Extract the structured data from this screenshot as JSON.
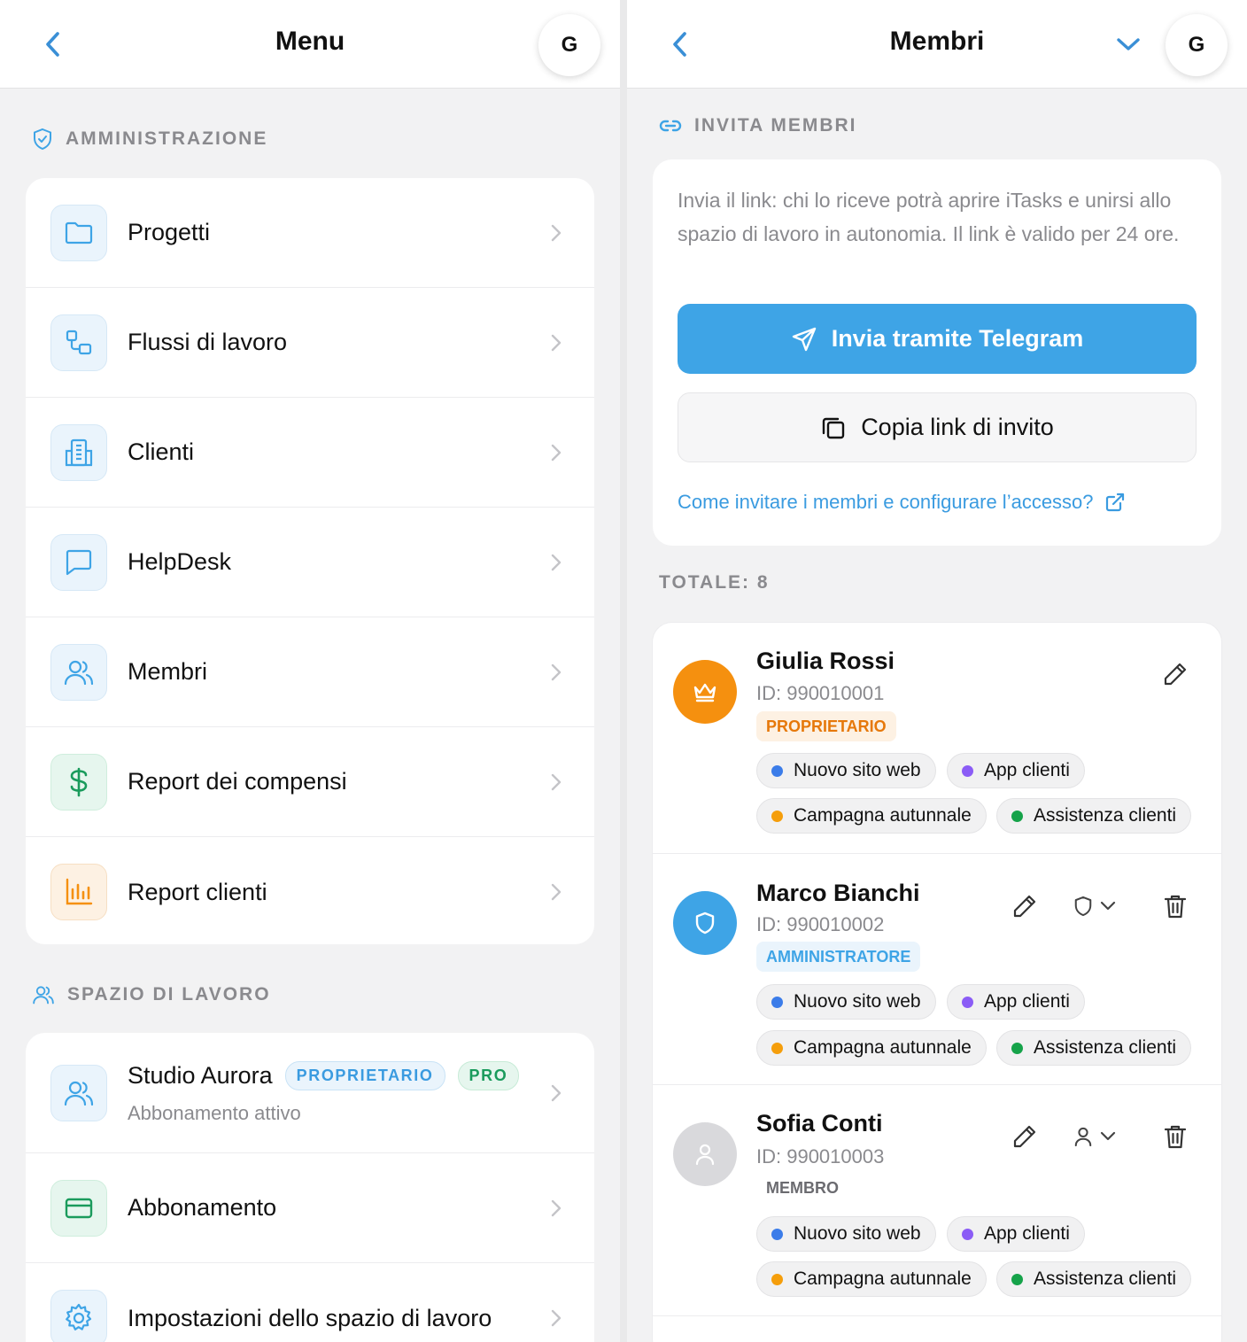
{
  "colors": {
    "accent": "#3ea4e6",
    "link": "#3a9be0",
    "owner_orange": "#f5900f",
    "admin_blue": "#3ea4e6",
    "member_gray": "#d9d9dc",
    "dot_blue": "#3b7ce9",
    "dot_purple": "#8b5cf6",
    "dot_orange": "#f59e0b",
    "dot_green": "#16a34a"
  },
  "left": {
    "header": {
      "title": "Menu",
      "avatar_initial": "G"
    },
    "admin_section": {
      "title": "AMMINISTRAZIONE",
      "icon": "shield-check-icon",
      "items": [
        {
          "label": "Progetti",
          "icon": "folder-icon"
        },
        {
          "label": "Flussi di lavoro",
          "icon": "workflow-icon"
        },
        {
          "label": "Clienti",
          "icon": "building-icon"
        },
        {
          "label": "HelpDesk",
          "icon": "chat-bubble-icon"
        },
        {
          "label": "Membri",
          "icon": "users-icon"
        },
        {
          "label": "Report dei compensi",
          "icon": "dollar-icon"
        },
        {
          "label": "Report clienti",
          "icon": "bar-chart-icon"
        }
      ]
    },
    "workspace_section": {
      "title": "SPAZIO DI LAVORO",
      "icon": "users-icon",
      "workspace": {
        "name": "Studio Aurora",
        "role_badge": "PROPRIETARIO",
        "plan_badge": "PRO",
        "subtitle": "Abbonamento attivo"
      },
      "items": [
        {
          "label": "Abbonamento",
          "icon": "credit-card-icon"
        },
        {
          "label": "Impostazioni dello spazio di lavoro",
          "icon": "gear-icon"
        }
      ]
    }
  },
  "right": {
    "header": {
      "title": "Membri",
      "avatar_initial": "G"
    },
    "invite": {
      "section_title": "INVITA MEMBRI",
      "description": "Invia il link: chi lo riceve potrà aprire iTasks e unirsi allo spazio di lavoro in autonomia. Il link è valido per 24 ore.",
      "telegram_button": "Invia tramite Telegram",
      "copy_button": "Copia link di invito",
      "help_link": "Come invitare i membri e configurare l’accesso?"
    },
    "total_label": "TOTALE: 8",
    "members": [
      {
        "name": "Giulia Rossi",
        "id": "ID: 990010001",
        "role": "PROPRIETARIO",
        "role_type": "owner",
        "projects": [
          "Nuovo sito web",
          "App clienti",
          "Campagna autunnale",
          "Assistenza clienti"
        ]
      },
      {
        "name": "Marco Bianchi",
        "id": "ID: 990010002",
        "role": "AMMINISTRATORE",
        "role_type": "admin",
        "projects": [
          "Nuovo sito web",
          "App clienti",
          "Campagna autunnale",
          "Assistenza clienti"
        ]
      },
      {
        "name": "Sofia Conti",
        "id": "ID: 990010003",
        "role": "MEMBRO",
        "role_type": "member",
        "projects": [
          "Nuovo sito web",
          "App clienti",
          "Campagna autunnale",
          "Assistenza clienti"
        ]
      }
    ]
  }
}
